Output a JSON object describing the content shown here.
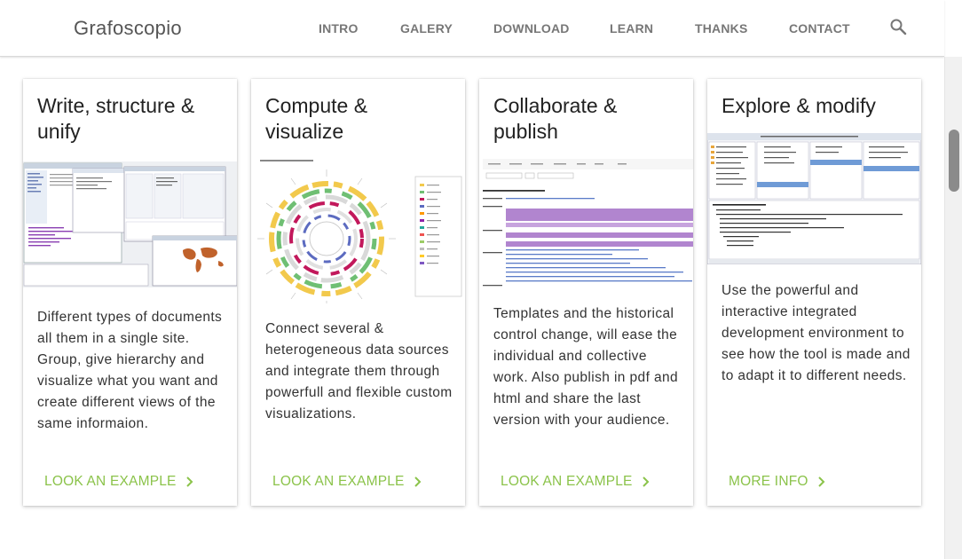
{
  "header": {
    "brand": "Grafoscopio",
    "nav": [
      {
        "label": "INTRO"
      },
      {
        "label": "GALERY"
      },
      {
        "label": "DOWNLOAD"
      },
      {
        "label": "LEARN"
      },
      {
        "label": "THANKS"
      },
      {
        "label": "CONTACT"
      }
    ],
    "search_icon": "search-icon"
  },
  "cards": [
    {
      "title_line1": "Write, structure &",
      "title_line2": "unify",
      "text": "Different types of documents all them in a single site. Group, give hierarchy and visualize what you want and create different views of the same informaion.",
      "action": "LOOK AN EXAMPLE"
    },
    {
      "title_line1": "Compute &",
      "title_line2": "visualize",
      "text": "Connect several & heterogeneous data sources and integrate them through powerfull and flexible custom visualizations.",
      "action": "LOOK AN EXAMPLE"
    },
    {
      "title_line1": "Collaborate &",
      "title_line2": "publish",
      "text": "Templates and the historical control change, will ease the individual and collective work. Also publish in pdf and html and share the last version with your audience.",
      "action": "LOOK AN EXAMPLE"
    },
    {
      "title_line1": "Explore & modify",
      "title_line2": "",
      "text": "Use the powerful and interactive integrated development environment to see how the tool is made and to adapt it to different needs.",
      "action": "MORE INFO"
    }
  ],
  "colors": {
    "accent": "#8bc34a",
    "brand_text": "#555555",
    "nav_text": "#777777"
  }
}
